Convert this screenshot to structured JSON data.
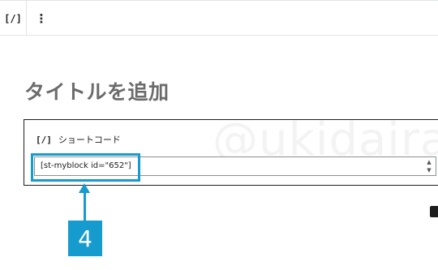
{
  "toolbar": {
    "block_icon": "[/]",
    "more_icon": "⋮"
  },
  "editor": {
    "title": "タイトルを追加"
  },
  "watermark": "@ukidaira",
  "shortcode_block": {
    "icon": "[/]",
    "label": "ショートコード",
    "input_value": "[st-myblock id=\"652\"]"
  },
  "annotation": {
    "step_number": "4",
    "color": "#169bcf"
  }
}
